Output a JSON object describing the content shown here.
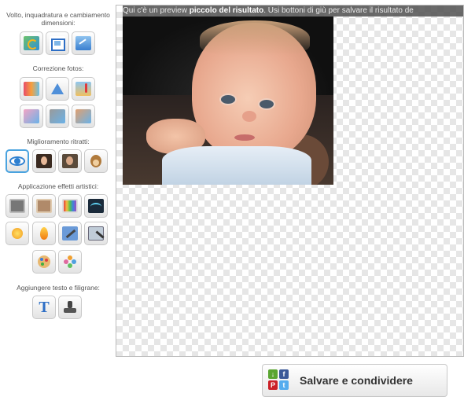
{
  "sidebar": {
    "sections": [
      {
        "title": "Volto, inquadratura e cambiamento dimensioni:"
      },
      {
        "title": "Correzione fotos:"
      },
      {
        "title": "Miglioramento ritratti:"
      },
      {
        "title": "Applicazione effetti artistici:"
      },
      {
        "title": "Aggiungere testo e filigrane:"
      }
    ],
    "text_tool_glyph": "T"
  },
  "canvas": {
    "info_text_pre": "Qui c'è un preview ",
    "info_text_bold": "piccolo del risultato",
    "info_text_post": ". Usi bottoni di giù per salvare il risultato de"
  },
  "footer": {
    "save_label": "Salvare e condividere",
    "social": {
      "facebook": "f",
      "pinterest": "P",
      "twitter": "t"
    }
  },
  "colors": {
    "accent_active": "#4aa3df",
    "facebook": "#3b5998",
    "pinterest": "#cb2027",
    "twitter": "#55acee",
    "download": "#5aa531"
  }
}
